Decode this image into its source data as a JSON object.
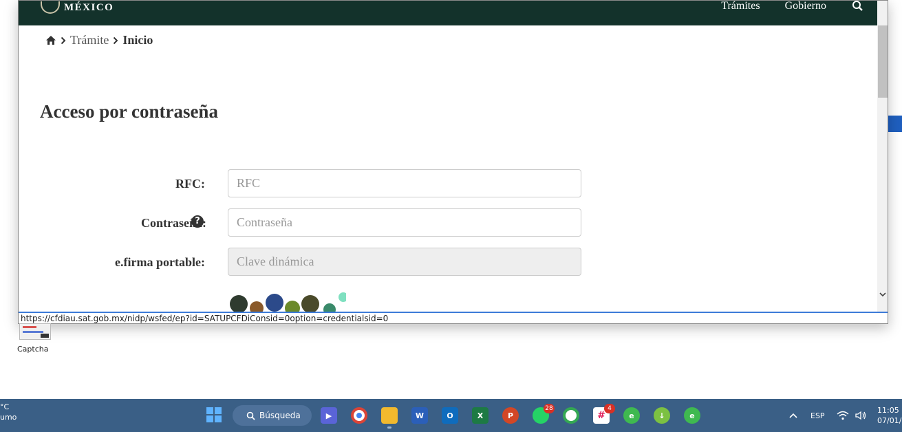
{
  "header": {
    "logo_text": "MÉXICO",
    "nav": [
      "Trámites",
      "Gobierno"
    ]
  },
  "breadcrumb": {
    "items": [
      "Trámite",
      "Inicio"
    ]
  },
  "form": {
    "title": "Acceso por contraseña",
    "fields": [
      {
        "label": "RFC:",
        "placeholder": "RFC"
      },
      {
        "label": "Contraseña:",
        "placeholder": "Contraseña"
      },
      {
        "label": "e.firma portable:",
        "placeholder": "Clave dinámica"
      }
    ]
  },
  "status_bar": {
    "url": "https://cfdiau.sat.gob.mx/nidp/wsfed/ep?id=SATUPCFDiConsid=0option=credentialsid=0"
  },
  "desktop": {
    "icon_label": "Captcha"
  },
  "taskbar": {
    "weather_temp": "°C",
    "weather_desc": "umo",
    "search_label": "Búsqueda",
    "whatsapp_badge": "28",
    "slack_badge": "4",
    "language": "ESP",
    "time": "11:05",
    "date": "07/01/"
  },
  "colors": {
    "header_bg": "#13322b",
    "taskbar_bg": "#3a5f86"
  }
}
